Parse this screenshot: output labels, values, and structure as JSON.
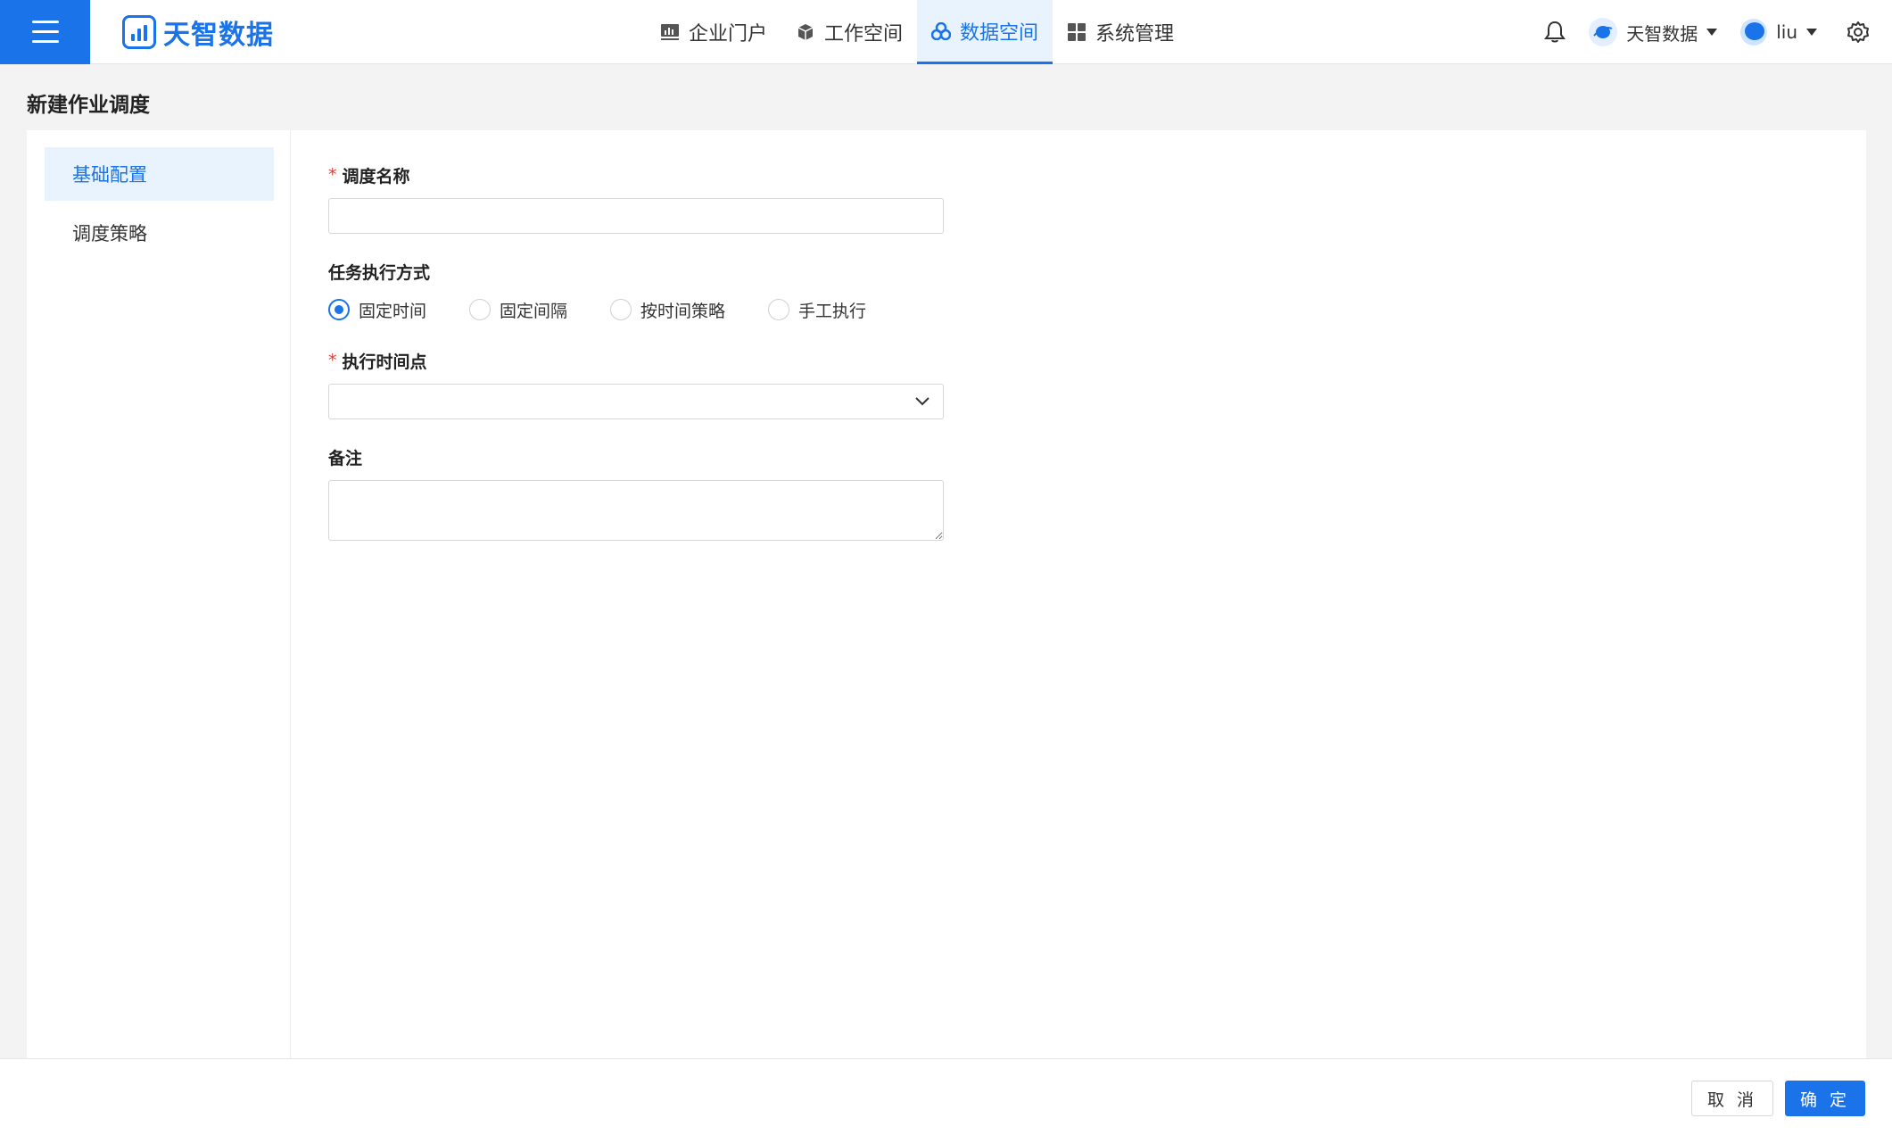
{
  "header": {
    "logo_text": "天智数据",
    "nav": [
      {
        "label": "企业门户",
        "icon": "chart-icon"
      },
      {
        "label": "工作空间",
        "icon": "cube-icon"
      },
      {
        "label": "数据空间",
        "icon": "cluster-icon",
        "active": true
      },
      {
        "label": "系统管理",
        "icon": "grid-icon"
      }
    ],
    "org_name": "天智数据",
    "user_name": "liu"
  },
  "page": {
    "title": "新建作业调度"
  },
  "sidebar": {
    "items": [
      {
        "label": "基础配置",
        "active": true
      },
      {
        "label": "调度策略",
        "active": false
      }
    ]
  },
  "form": {
    "schedule_name": {
      "label": "调度名称",
      "value": "",
      "required": true
    },
    "exec_mode": {
      "label": "任务执行方式",
      "options": [
        "固定时间",
        "固定间隔",
        "按时间策略",
        "手工执行"
      ],
      "selected": "固定时间"
    },
    "exec_time": {
      "label": "执行时间点",
      "value": "",
      "required": true
    },
    "remark": {
      "label": "备注",
      "value": ""
    },
    "required_mark": "*"
  },
  "footer": {
    "cancel_label": "取 消",
    "ok_label": "确 定"
  },
  "colors": {
    "primary": "#1a73e8",
    "active_bg": "#e8f3fd",
    "required": "#e53935"
  }
}
